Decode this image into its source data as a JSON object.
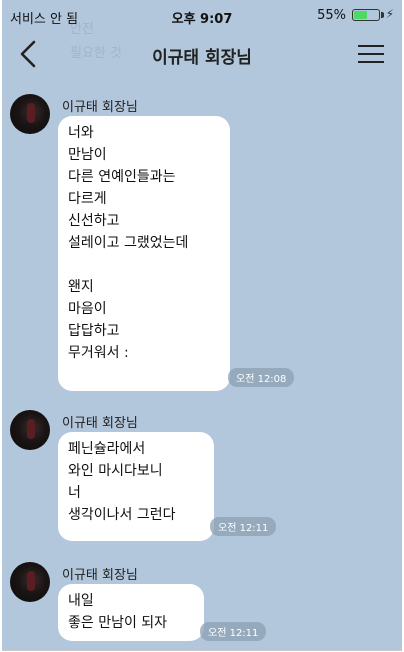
{
  "status_bar": {
    "carrier": "서비스 안 됨",
    "time": "오후 9:07",
    "battery_percent": "55%",
    "battery_level": 0.55,
    "charging_icon": "bolt-icon"
  },
  "ghost_text": [
    "안전",
    "필요한 것"
  ],
  "header": {
    "title": "이규태 회장님",
    "back_icon": "chevron-left-icon",
    "menu_icon": "hamburger-menu-icon"
  },
  "messages": [
    {
      "sender": "이규태 회장님",
      "text": "너와\n만남이\n다른 연예인들과는\n다르게\n신선하고\n설레이고 그랬었는데\n\n왠지\n마음이\n답답하고\n무거워서 :",
      "timestamp": "오전 12:08"
    },
    {
      "sender": "이규태 회장님",
      "text": "페닌슐라에서\n와인 마시다보니\n너\n생각이나서 그런다",
      "timestamp": "오전 12:11"
    },
    {
      "sender": "이규태 회장님",
      "text": "내일\n좋은 만남이 되자",
      "timestamp": "오전 12:11"
    }
  ],
  "colors": {
    "chat_background": "#b2c6dc",
    "bubble": "#ffffff",
    "timestamp_pill": "#8ca0b4"
  }
}
